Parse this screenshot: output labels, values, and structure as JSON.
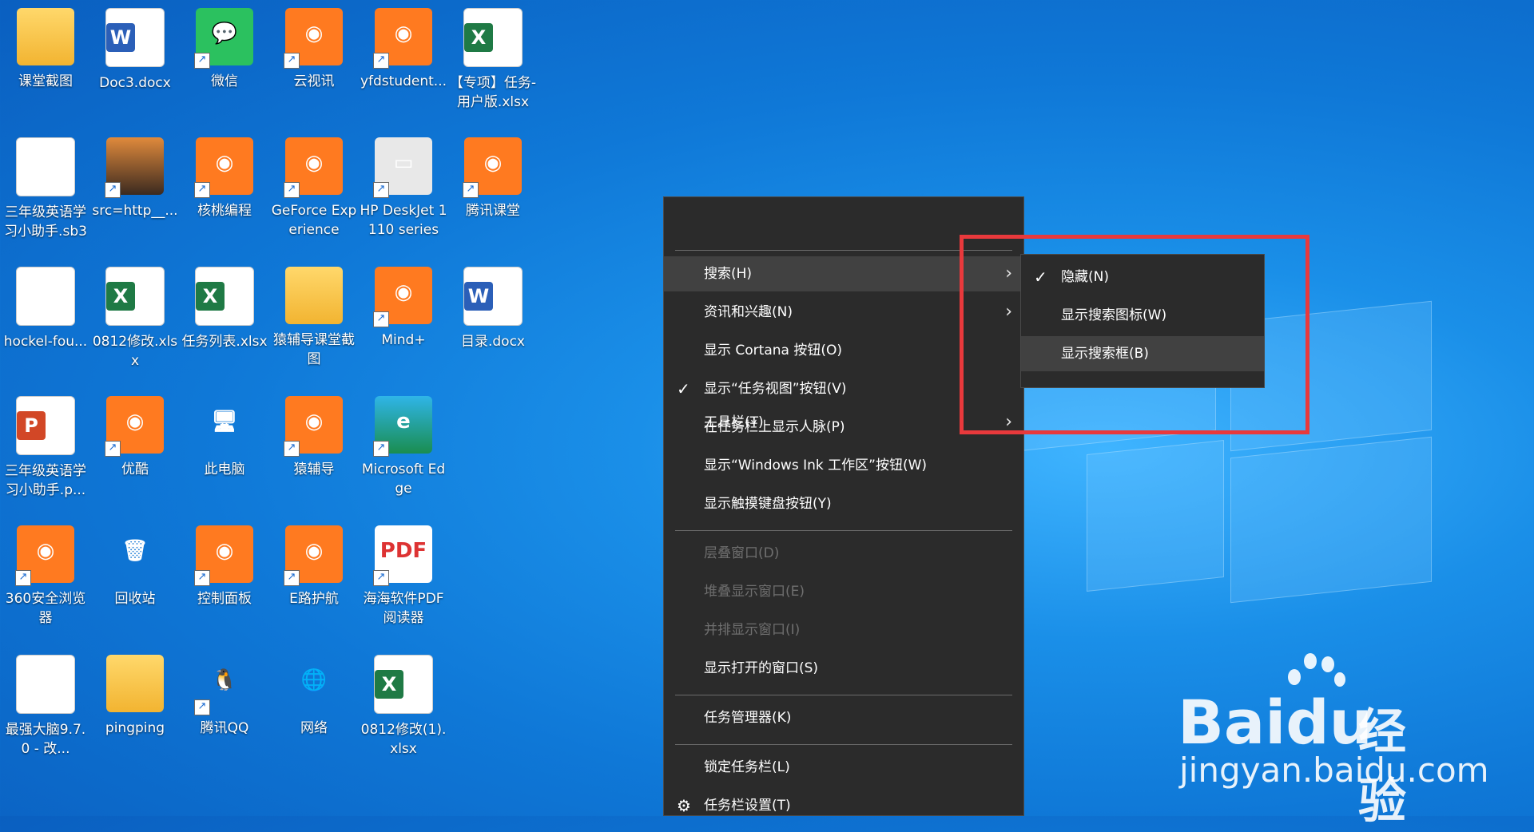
{
  "desktop_icons": [
    {
      "label": "课堂截图",
      "type": "folder"
    },
    {
      "label": "Doc3.docx",
      "type": "word"
    },
    {
      "label": "微信",
      "type": "wechat"
    },
    {
      "label": "云视讯",
      "type": "app"
    },
    {
      "label": "yfdstudent...",
      "type": "app"
    },
    {
      "label": "【专项】任务-用户版.xlsx",
      "type": "excel"
    },
    {
      "label": "三年级英语学习小助手.sb3",
      "type": "doc"
    },
    {
      "label": "src=http__...",
      "type": "image"
    },
    {
      "label": "核桃编程",
      "type": "app"
    },
    {
      "label": "GeForce Experience",
      "type": "app"
    },
    {
      "label": "HP DeskJet 1110 series",
      "type": "printer"
    },
    {
      "label": "腾讯课堂",
      "type": "app"
    },
    {
      "label": "hockel-fou...",
      "type": "doc"
    },
    {
      "label": "0812修改.xlsx",
      "type": "excel"
    },
    {
      "label": "任务列表.xlsx",
      "type": "excel"
    },
    {
      "label": "猿辅导课堂截图",
      "type": "folder"
    },
    {
      "label": "Mind+",
      "type": "app"
    },
    {
      "label": "目录.docx",
      "type": "word"
    },
    {
      "label": "三年级英语学习小助手.p...",
      "type": "ppt"
    },
    {
      "label": "优酷",
      "type": "app"
    },
    {
      "label": "此电脑",
      "type": "computer"
    },
    {
      "label": "猿辅导",
      "type": "app"
    },
    {
      "label": "Microsoft Edge",
      "type": "edge"
    },
    {
      "label": "360安全浏览器",
      "type": "app"
    },
    {
      "label": "回收站",
      "type": "recycle"
    },
    {
      "label": "控制面板",
      "type": "app"
    },
    {
      "label": "E路护航",
      "type": "app"
    },
    {
      "label": "海海软件PDF阅读器",
      "type": "pdf"
    },
    {
      "label": "最强大脑9.7.0 - 改...",
      "type": "doc"
    },
    {
      "label": "pingping",
      "type": "folder"
    },
    {
      "label": "腾讯QQ",
      "type": "qq"
    },
    {
      "label": "网络",
      "type": "network"
    },
    {
      "label": "0812修改(1).xlsx",
      "type": "excel"
    }
  ],
  "context_menu": {
    "items": [
      {
        "label": "工具栏(T)",
        "submenu": true
      },
      {
        "label": "搜索(H)",
        "submenu": true,
        "highlighted": true
      },
      {
        "label": "资讯和兴趣(N)",
        "submenu": true
      },
      {
        "label": "显示 Cortana 按钮(O)"
      },
      {
        "label": "显示“任务视图”按钮(V)",
        "checked": true
      },
      {
        "label": "在任务栏上显示人脉(P)"
      },
      {
        "label": "显示“Windows Ink 工作区”按钮(W)"
      },
      {
        "label": "显示触摸键盘按钮(Y)"
      },
      {
        "label": "层叠窗口(D)",
        "disabled": true
      },
      {
        "label": "堆叠显示窗口(E)",
        "disabled": true
      },
      {
        "label": "并排显示窗口(I)",
        "disabled": true
      },
      {
        "label": "显示打开的窗口(S)"
      },
      {
        "label": "任务管理器(K)"
      },
      {
        "label": "锁定任务栏(L)"
      },
      {
        "label": "任务栏设置(T)",
        "icon": "gear-icon"
      }
    ]
  },
  "search_submenu": {
    "items": [
      {
        "label": "隐藏(N)",
        "checked": true
      },
      {
        "label": "显示搜索图标(W)"
      },
      {
        "label": "显示搜索框(B)",
        "highlighted": true
      }
    ]
  },
  "watermark": {
    "brand": "Bai",
    "brand2": "du",
    "brand_cn": "经验",
    "url": "jingyan.baidu.com"
  },
  "colors": {
    "menu_bg": "#2b2b2b",
    "menu_highlight": "#414141",
    "annotation_red": "#e8393c",
    "desktop": "#0f78d7"
  }
}
